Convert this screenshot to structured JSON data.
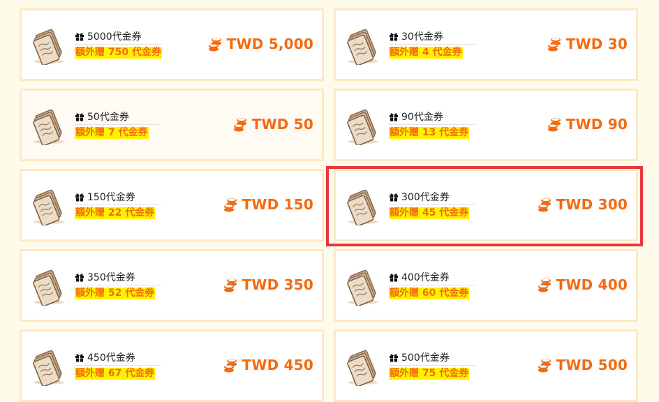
{
  "cards": [
    {
      "name": "5000代金券",
      "bonus": "額外贈 750 代金券",
      "price": "TWD 5,000"
    },
    {
      "name": "30代金券",
      "bonus": "額外贈 4 代金券",
      "price": "TWD 30"
    },
    {
      "name": "50代金券",
      "bonus": "額外贈 7 代金券",
      "price": "TWD 50"
    },
    {
      "name": "90代金券",
      "bonus": "額外贈 13 代金券",
      "price": "TWD 90"
    },
    {
      "name": "150代金券",
      "bonus": "額外贈 22 代金券",
      "price": "TWD 150"
    },
    {
      "name": "300代金券",
      "bonus": "額外贈 45 代金券",
      "price": "TWD 300",
      "selected": true
    },
    {
      "name": "350代金券",
      "bonus": "額外贈 52 代金券",
      "price": "TWD 350"
    },
    {
      "name": "400代金券",
      "bonus": "額外贈 60 代金券",
      "price": "TWD 400"
    },
    {
      "name": "450代金券",
      "bonus": "額外贈 67 代金券",
      "price": "TWD 450"
    },
    {
      "name": "500代金券",
      "bonus": "額外贈 75 代金券",
      "price": "TWD 500"
    }
  ],
  "icons": {
    "ticket": "ticket-icon",
    "gift": "gift-icon",
    "coins": "coins-icon"
  },
  "colors": {
    "accent": "#f26b10",
    "bonus_highlight": "#fff200",
    "card_border": "#fde9c7",
    "page_background": "#fffbeb",
    "selection_frame": "#e8373d"
  }
}
